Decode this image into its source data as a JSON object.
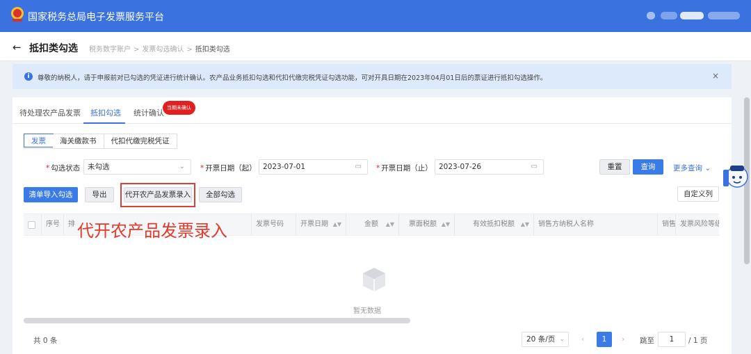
{
  "header": {
    "title": "国家税务总局电子发票服务平台",
    "brand_color": "#3a72e0"
  },
  "subheader": {
    "page_title": "抵扣类勾选",
    "breadcrumb": [
      "税务数字账户",
      "发票勾选确认",
      "抵扣类勾选"
    ],
    "breadcrumb_separator": ">"
  },
  "notice": {
    "text": "尊敬的纳税人，请于申报前对已勾选的凭证进行统计确认。农产品业务抵扣勾选和代扣代缴完税凭证勾选功能，可对开具日期在2023年04月01日后的票证进行抵扣勾选操作。",
    "close": "×"
  },
  "tabs": [
    {
      "label": "待处理农产品发票",
      "active": false
    },
    {
      "label": "抵扣勾选",
      "active": true
    },
    {
      "label": "统计确认",
      "active": false
    }
  ],
  "tab_badge": "当期未确认",
  "subtabs": [
    {
      "label": "发票",
      "active": true
    },
    {
      "label": "海关缴款书",
      "active": false
    },
    {
      "label": "代扣代缴完税凭证",
      "active": false
    }
  ],
  "filters": {
    "status_label": "勾选状态",
    "status_value": "未勾选",
    "start_label": "开票日期（起）",
    "start_value": "2023-07-01",
    "end_label": "开票日期（止）",
    "end_value": "2023-07-26",
    "reset": "重置",
    "query": "查询",
    "more": "更多查询"
  },
  "actions": {
    "import": "清单导入勾选",
    "export": "导出",
    "agri_entry": "代开农产品发票录入",
    "select_all": "全部勾选",
    "custom_columns": "自定义列"
  },
  "overlay_label": "代开农产品发票录入",
  "table": {
    "columns": [
      "序号",
      "排",
      "发票号码",
      "开票日期",
      "金额",
      "票面税额",
      "有效抵扣税额",
      "销售方纳税人名称",
      "销售",
      "发票风险等级"
    ],
    "empty_text": "暂无数据"
  },
  "pagination": {
    "total": "共 0 条",
    "page_size": "20 条/页",
    "current_page": "1",
    "jump_label": "跳至",
    "jump_value": "1",
    "total_pages": "/ 1 页"
  },
  "icons": {
    "back": "arrow-left-icon",
    "info": "info-circle-icon",
    "close": "close-icon",
    "calendar": "calendar-icon",
    "chevron": "chevron-down-icon",
    "empty": "empty-box-icon"
  }
}
